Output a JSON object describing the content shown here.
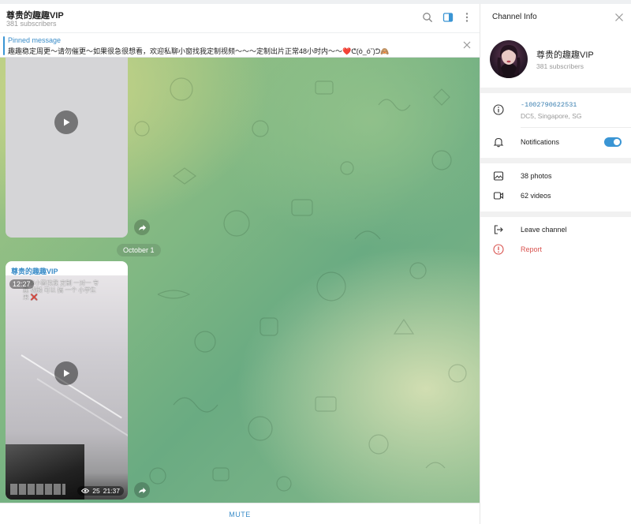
{
  "chat": {
    "title": "尊贵的趣趣VIP",
    "subscribers": "381 subscribers"
  },
  "pinned": {
    "title": "Pinned message",
    "text": "趣趣稳定周更～请勿催更～如果很急很想看，欢迎私聊小窗找我定制视频～～～定制出片正常48小时内～～❤️ᕦ(ò_óˇ)ᕤ🙈"
  },
  "date_separator": "October 1",
  "messages": [
    {
      "kind": "video"
    },
    {
      "kind": "video",
      "sender": "尊贵的趣趣VIP",
      "duration": "12:27",
      "overlay_text": "私聊小窗找我 定制 一对一 专属 视频 可以 搞 一个 小学生 来 ❌",
      "views": "25",
      "time": "21:37"
    }
  ],
  "composer": {
    "mute_label": "MUTE"
  },
  "info": {
    "header_title": "Channel Info",
    "name": "尊贵的趣趣VIP",
    "subscribers": "381 subscribers",
    "channel_id": "-1002790622531",
    "dc": "DC5, Singapore, SG",
    "notifications_label": "Notifications",
    "notifications_on": true,
    "photos": "38 photos",
    "videos": "62 videos",
    "leave": "Leave channel",
    "report": "Report"
  },
  "colors": {
    "accent": "#3a95d4",
    "danger": "#d9534f"
  },
  "icons": [
    "search-icon",
    "sidebar-toggle-icon",
    "more-icon",
    "close-icon",
    "play-icon",
    "share-icon",
    "eye-icon",
    "info-icon",
    "bell-icon",
    "photo-icon",
    "video-icon",
    "logout-icon",
    "alert-icon"
  ]
}
